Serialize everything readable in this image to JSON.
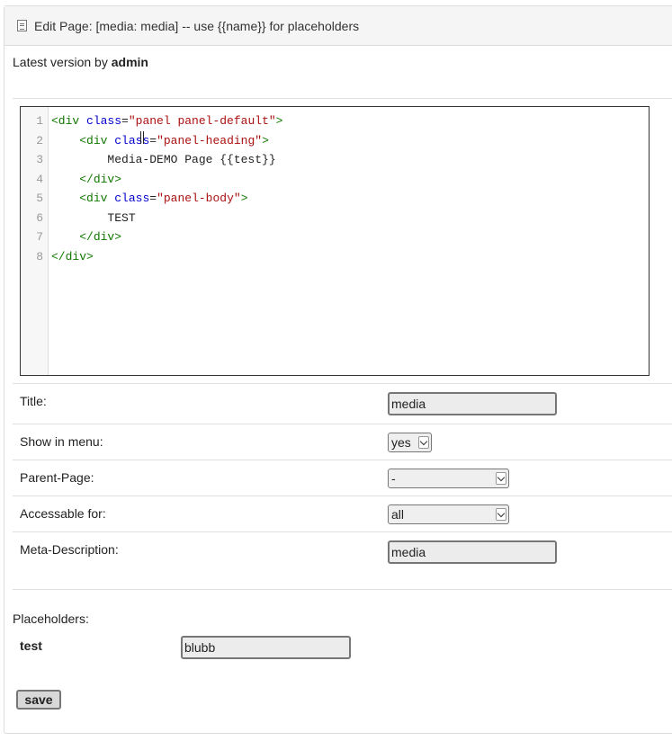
{
  "header": {
    "icon": "document-icon",
    "title": "Edit Page: [media: media] -- use {{name}} for placeholders"
  },
  "version": {
    "prefix": "Latest version by",
    "user": "admin"
  },
  "editor": {
    "line_numbers": [
      "1",
      "2",
      "3",
      "4",
      "5",
      "6",
      "7",
      "8"
    ],
    "lines": [
      [
        {
          "t": "tag",
          "v": "<div "
        },
        {
          "t": "attr",
          "v": "class"
        },
        {
          "t": "txt",
          "v": "="
        },
        {
          "t": "str",
          "v": "\"panel panel-default\""
        },
        {
          "t": "tag",
          "v": ">"
        }
      ],
      [
        {
          "t": "txt",
          "v": "    "
        },
        {
          "t": "tag",
          "v": "<div "
        },
        {
          "t": "attr",
          "v": "class"
        },
        {
          "t": "txt",
          "v": "="
        },
        {
          "t": "str",
          "v": "\"panel-heading\""
        },
        {
          "t": "tag",
          "v": ">"
        }
      ],
      [
        {
          "t": "txt",
          "v": "        Media-DEMO Page {{test}}"
        }
      ],
      [
        {
          "t": "txt",
          "v": "    "
        },
        {
          "t": "tag",
          "v": "</div>"
        }
      ],
      [
        {
          "t": "txt",
          "v": "    "
        },
        {
          "t": "tag",
          "v": "<div "
        },
        {
          "t": "attr",
          "v": "class"
        },
        {
          "t": "txt",
          "v": "="
        },
        {
          "t": "str",
          "v": "\"panel-body\""
        },
        {
          "t": "tag",
          "v": ">"
        }
      ],
      [
        {
          "t": "txt",
          "v": "        TEST"
        }
      ],
      [
        {
          "t": "txt",
          "v": "    "
        },
        {
          "t": "tag",
          "v": "</div>"
        }
      ],
      [
        {
          "t": "tag",
          "v": "</div>"
        }
      ]
    ],
    "colors": {
      "tag": "#117700",
      "attr": "#0000cc",
      "str": "#aa1111",
      "txt": "#222222"
    }
  },
  "form": {
    "title_label": "Title:",
    "title_value": "media",
    "menu_label": "Show in menu:",
    "menu_value": "yes",
    "parent_label": "Parent-Page:",
    "parent_value": "-",
    "access_label": "Accessable for:",
    "access_value": "all",
    "meta_label": "Meta-Description:",
    "meta_value": "media"
  },
  "placeholders": {
    "title": "Placeholders:",
    "items": [
      {
        "name": "test",
        "value": "blubb"
      }
    ]
  },
  "actions": {
    "save_label": "save"
  }
}
